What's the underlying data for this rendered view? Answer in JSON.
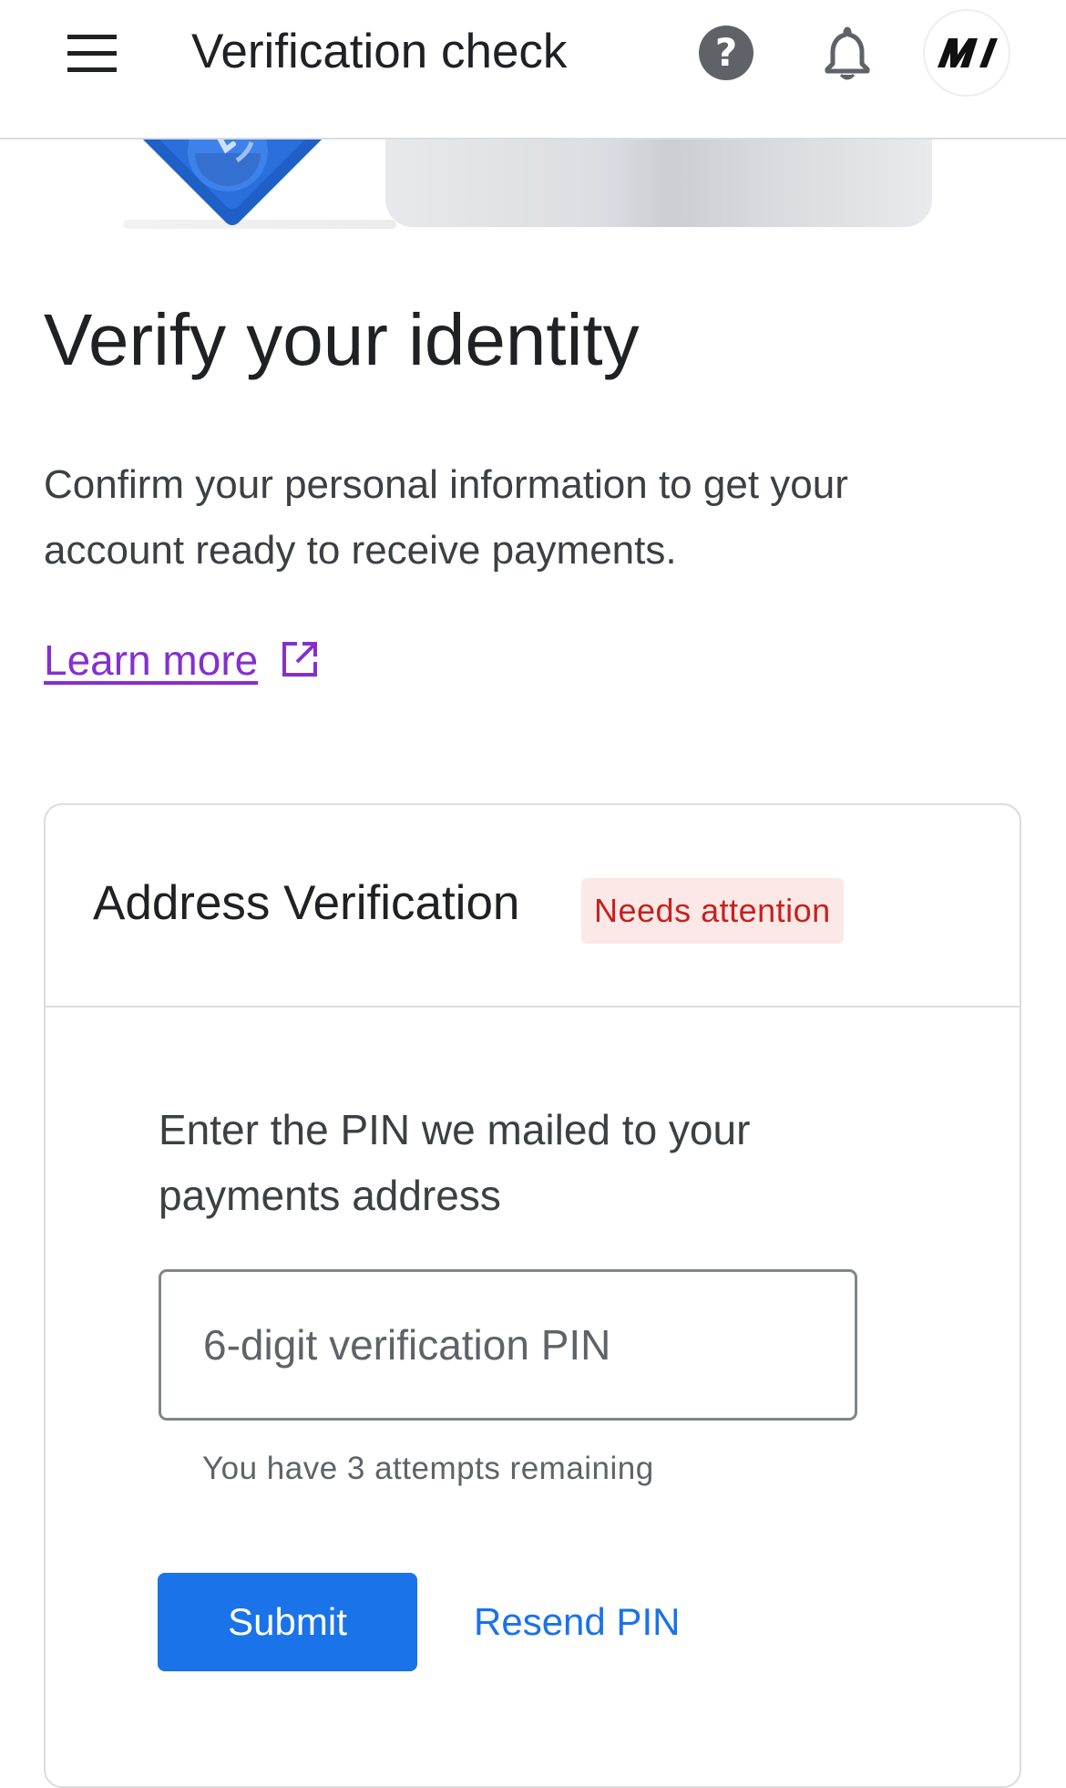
{
  "header": {
    "title": "Verification check",
    "menu_icon": "hamburger-menu-icon",
    "help_icon": "help-circle-icon",
    "notifications_icon": "bell-icon",
    "avatar_icon": "account-logo-icon"
  },
  "hero": {
    "illustration": "verification-illustration"
  },
  "intro": {
    "title": "Verify your identity",
    "subtitle": "Confirm your personal information to get your account ready to receive payments.",
    "learn_more_label": "Learn more",
    "learn_more_icon": "open-in-new-icon"
  },
  "card": {
    "title": "Address Verification",
    "status": "Needs attention",
    "instruction": "Enter the PIN we mailed to your payments address",
    "pin_input": {
      "value": "",
      "placeholder": "6-digit verification PIN"
    },
    "helper_text": "You have 3 attempts remaining",
    "submit_label": "Submit",
    "resend_label": "Resend PIN"
  },
  "colors": {
    "primary": "#1a73e8",
    "link_visited": "#8430ce",
    "status_text": "#c5221f",
    "status_background": "#fce8e6",
    "divider": "#dadce0"
  }
}
